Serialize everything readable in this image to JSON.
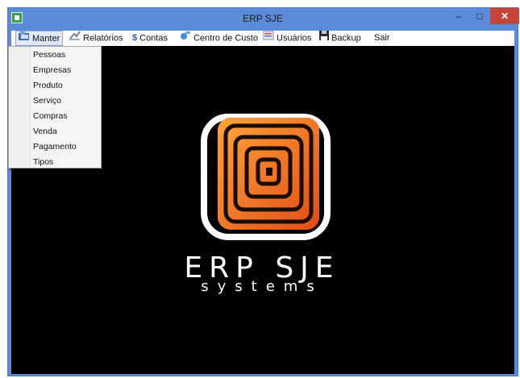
{
  "window": {
    "title": "ERP SJE"
  },
  "title_controls": {
    "minimize": "–",
    "maximize": "□",
    "close": "✕"
  },
  "menubar": {
    "items": [
      {
        "label": "Manter",
        "icon": "folder-icon"
      },
      {
        "label": "Relatórios",
        "icon": "report-icon"
      },
      {
        "label": "Contas",
        "icon": "dollar-icon"
      },
      {
        "label": "Centro de Custo",
        "icon": "tools-icon"
      },
      {
        "label": "Usuários",
        "icon": "users-icon"
      },
      {
        "label": "Backup",
        "icon": "save-icon"
      },
      {
        "label": "Sair",
        "icon": ""
      }
    ]
  },
  "dropdown": {
    "items": [
      "Pessoas",
      "Empresas",
      "Produto",
      "Serviço",
      "Compras",
      "Venda",
      "Pagamento",
      "Tipos"
    ]
  },
  "logo": {
    "brand": "ERP SJE",
    "tagline": "systems"
  },
  "colors": {
    "accent": "#f26a1c",
    "titlebar": "#5b8bd8",
    "close": "#c7443a",
    "background": "#000000"
  }
}
